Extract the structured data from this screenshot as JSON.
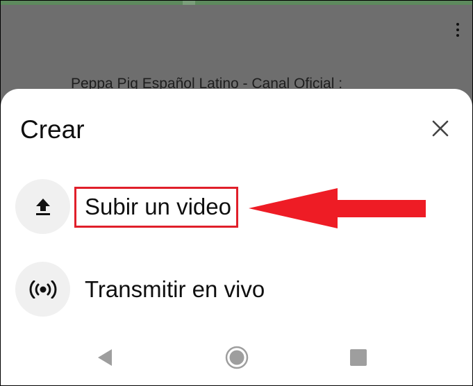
{
  "background": {
    "video_channel_text": "Peppa Pig Español Latino - Canal Oficial :",
    "more_icon": "more-vert-icon"
  },
  "sheet": {
    "title": "Crear",
    "close_icon": "close-icon",
    "items": [
      {
        "label": "Subir un video",
        "icon": "upload-icon"
      },
      {
        "label": "Transmitir en vivo",
        "icon": "live-broadcast-icon"
      }
    ]
  },
  "annotation": {
    "highlight_color": "#e01f2a",
    "arrow_color": "#ee1c25"
  },
  "nav": {
    "back_icon": "back-triangle-icon",
    "home_icon": "home-circle-icon",
    "recents_icon": "recents-square-icon"
  }
}
